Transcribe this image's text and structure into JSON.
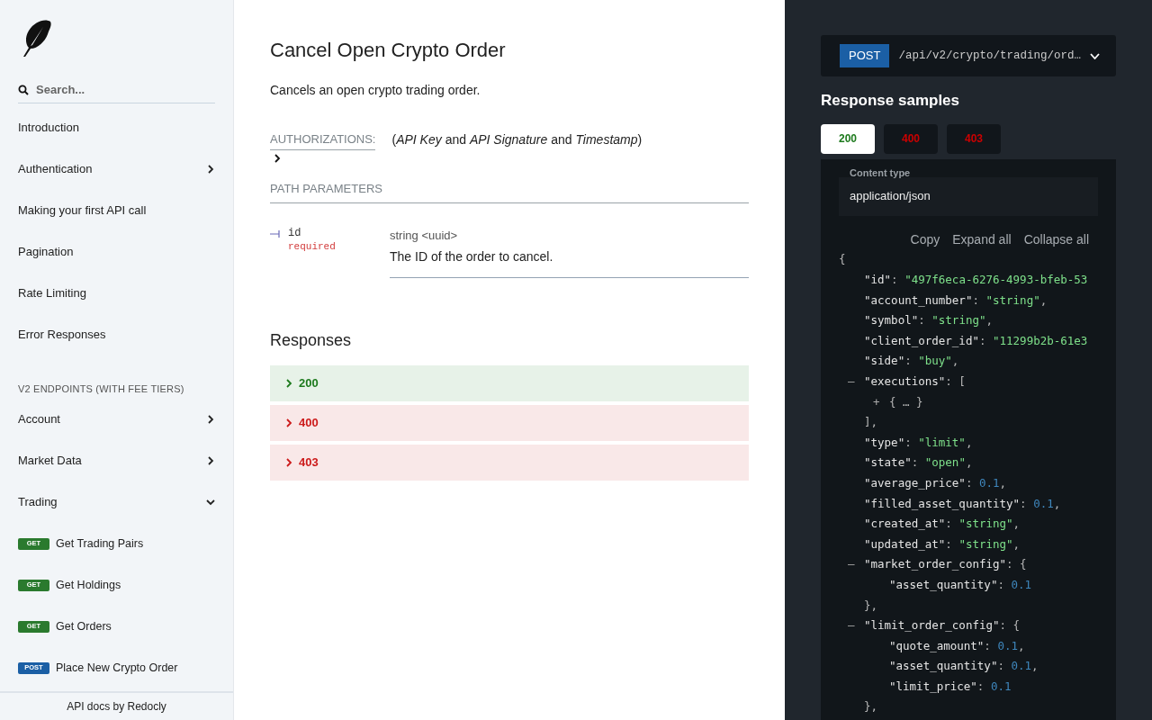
{
  "sidebar": {
    "search": {
      "placeholder": "Search..."
    },
    "items": [
      {
        "kind": "item",
        "label": "Introduction"
      },
      {
        "kind": "item",
        "label": "Authentication",
        "expanded": false
      },
      {
        "kind": "item",
        "label": "Making your first API call"
      },
      {
        "kind": "item",
        "label": "Pagination"
      },
      {
        "kind": "item",
        "label": "Rate Limiting"
      },
      {
        "kind": "item",
        "label": "Error Responses"
      },
      {
        "kind": "section",
        "label": "V2 ENDPOINTS (WITH FEE TIERS)"
      },
      {
        "kind": "item",
        "label": "Account",
        "expanded": false
      },
      {
        "kind": "item",
        "label": "Market Data",
        "expanded": false
      },
      {
        "kind": "item",
        "label": "Trading",
        "expanded": true
      },
      {
        "kind": "operation",
        "method": "GET",
        "label": "Get Trading Pairs"
      },
      {
        "kind": "operation",
        "method": "GET",
        "label": "Get Holdings"
      },
      {
        "kind": "operation",
        "method": "GET",
        "label": "Get Orders"
      },
      {
        "kind": "operation",
        "method": "POST",
        "label": "Place New Crypto Order"
      }
    ],
    "footer": "API docs by Redocly"
  },
  "main": {
    "title": "Cancel Open Crypto Order",
    "description": "Cancels an open crypto trading order.",
    "authorizations": {
      "label": "AUTHORIZATIONS:",
      "value": "(*API Key* and *API Signature* and *Timestamp*)",
      "expanded": false
    },
    "path_parameters": {
      "heading": "PATH PARAMETERS",
      "params": [
        {
          "name": "id",
          "required": "required",
          "type": "string <uuid>",
          "description": "The ID of the order to cancel."
        }
      ]
    },
    "responses": {
      "heading": "Responses",
      "items": [
        {
          "code": "200",
          "kind": "success",
          "expanded": false
        },
        {
          "code": "400",
          "kind": "error",
          "expanded": false
        },
        {
          "code": "403",
          "kind": "error",
          "expanded": false
        }
      ]
    }
  },
  "samples": {
    "endpoint": {
      "method": "POST",
      "path": "/api/v2/crypto/trading/ord…",
      "expanded": false
    },
    "title": "Response samples",
    "tabs": [
      {
        "code": "200",
        "kind": "success",
        "selected": true
      },
      {
        "code": "400",
        "kind": "error",
        "selected": false
      },
      {
        "code": "403",
        "kind": "error",
        "selected": false
      }
    ],
    "content_type": {
      "label": "Content type",
      "value": "application/json"
    },
    "actions": [
      "Copy",
      "Expand all",
      "Collapse all"
    ],
    "code": {
      "tokens": [
        {
          "kind": "punct",
          "text": "{"
        }
      ],
      "children": [
        {
          "tokens": [
            {
              "kind": "key",
              "text": "\"id\""
            },
            {
              "kind": "punct",
              "text": ": "
            },
            {
              "kind": "string",
              "text": "\"497f6eca-6276-4993-bfeb-53"
            }
          ]
        },
        {
          "tokens": [
            {
              "kind": "key",
              "text": "\"account_number\""
            },
            {
              "kind": "punct",
              "text": ": "
            },
            {
              "kind": "string",
              "text": "\"string\""
            },
            {
              "kind": "punct",
              "text": ","
            }
          ]
        },
        {
          "tokens": [
            {
              "kind": "key",
              "text": "\"symbol\""
            },
            {
              "kind": "punct",
              "text": ": "
            },
            {
              "kind": "string",
              "text": "\"string\""
            },
            {
              "kind": "punct",
              "text": ","
            }
          ]
        },
        {
          "tokens": [
            {
              "kind": "key",
              "text": "\"client_order_id\""
            },
            {
              "kind": "punct",
              "text": ": "
            },
            {
              "kind": "string",
              "text": "\"11299b2b-61e3"
            }
          ]
        },
        {
          "tokens": [
            {
              "kind": "key",
              "text": "\"side\""
            },
            {
              "kind": "punct",
              "text": ": "
            },
            {
              "kind": "string",
              "text": "\"buy\""
            },
            {
              "kind": "punct",
              "text": ","
            }
          ]
        },
        {
          "toggle": "–",
          "tokens": [
            {
              "kind": "key",
              "text": "\"executions\""
            },
            {
              "kind": "punct",
              "text": ": ["
            }
          ],
          "children": [
            {
              "toggle": "+",
              "tokens": [
                {
                  "kind": "punct",
                  "text": "{ … }"
                }
              ]
            }
          ],
          "close": "],"
        },
        {
          "tokens": [
            {
              "kind": "key",
              "text": "\"type\""
            },
            {
              "kind": "punct",
              "text": ": "
            },
            {
              "kind": "string",
              "text": "\"limit\""
            },
            {
              "kind": "punct",
              "text": ","
            }
          ]
        },
        {
          "tokens": [
            {
              "kind": "key",
              "text": "\"state\""
            },
            {
              "kind": "punct",
              "text": ": "
            },
            {
              "kind": "string",
              "text": "\"open\""
            },
            {
              "kind": "punct",
              "text": ","
            }
          ]
        },
        {
          "tokens": [
            {
              "kind": "key",
              "text": "\"average_price\""
            },
            {
              "kind": "punct",
              "text": ": "
            },
            {
              "kind": "number",
              "text": "0.1"
            },
            {
              "kind": "punct",
              "text": ","
            }
          ]
        },
        {
          "tokens": [
            {
              "kind": "key",
              "text": "\"filled_asset_quantity\""
            },
            {
              "kind": "punct",
              "text": ": "
            },
            {
              "kind": "number",
              "text": "0.1"
            },
            {
              "kind": "punct",
              "text": ","
            }
          ]
        },
        {
          "tokens": [
            {
              "kind": "key",
              "text": "\"created_at\""
            },
            {
              "kind": "punct",
              "text": ": "
            },
            {
              "kind": "string",
              "text": "\"string\""
            },
            {
              "kind": "punct",
              "text": ","
            }
          ]
        },
        {
          "tokens": [
            {
              "kind": "key",
              "text": "\"updated_at\""
            },
            {
              "kind": "punct",
              "text": ": "
            },
            {
              "kind": "string",
              "text": "\"string\""
            },
            {
              "kind": "punct",
              "text": ","
            }
          ]
        },
        {
          "toggle": "–",
          "tokens": [
            {
              "kind": "key",
              "text": "\"market_order_config\""
            },
            {
              "kind": "punct",
              "text": ": {"
            }
          ],
          "children": [
            {
              "tokens": [
                {
                  "kind": "key",
                  "text": "\"asset_quantity\""
                },
                {
                  "kind": "punct",
                  "text": ": "
                },
                {
                  "kind": "number",
                  "text": "0.1"
                }
              ]
            }
          ],
          "close": "},"
        },
        {
          "toggle": "–",
          "tokens": [
            {
              "kind": "key",
              "text": "\"limit_order_config\""
            },
            {
              "kind": "punct",
              "text": ": {"
            }
          ],
          "children": [
            {
              "tokens": [
                {
                  "kind": "key",
                  "text": "\"quote_amount\""
                },
                {
                  "kind": "punct",
                  "text": ": "
                },
                {
                  "kind": "number",
                  "text": "0.1"
                },
                {
                  "kind": "punct",
                  "text": ","
                }
              ]
            },
            {
              "tokens": [
                {
                  "kind": "key",
                  "text": "\"asset_quantity\""
                },
                {
                  "kind": "punct",
                  "text": ": "
                },
                {
                  "kind": "number",
                  "text": "0.1"
                },
                {
                  "kind": "punct",
                  "text": ","
                }
              ]
            },
            {
              "tokens": [
                {
                  "kind": "key",
                  "text": "\"limit_price\""
                },
                {
                  "kind": "punct",
                  "text": ": "
                },
                {
                  "kind": "number",
                  "text": "0.1"
                }
              ]
            }
          ],
          "close": "},"
        }
      ]
    }
  }
}
